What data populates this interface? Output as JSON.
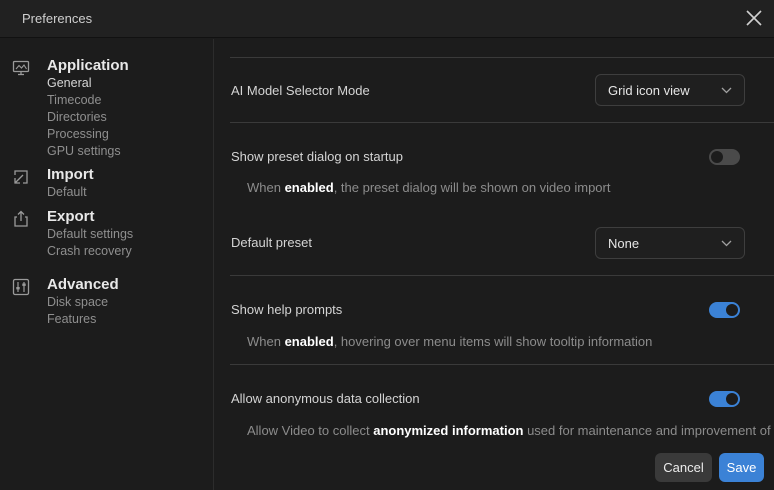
{
  "window": {
    "title": "Preferences"
  },
  "sidebar": {
    "sections": [
      {
        "heading": "Application",
        "icon": "monitor-icon",
        "items": [
          "General",
          "Timecode",
          "Directories",
          "Processing",
          "GPU settings"
        ]
      },
      {
        "heading": "Import",
        "icon": "import-icon",
        "items": [
          "Default"
        ]
      },
      {
        "heading": "Export",
        "icon": "export-icon",
        "items": [
          "Default settings",
          "Crash recovery"
        ]
      },
      {
        "heading": "Advanced",
        "icon": "sliders-icon",
        "items": [
          "Disk space",
          "Features"
        ]
      }
    ],
    "active_item": "General"
  },
  "settings": {
    "ai_model_selector": {
      "label": "AI Model Selector Mode",
      "value": "Grid icon view"
    },
    "preset_dialog": {
      "label": "Show preset dialog on startup",
      "enabled": false,
      "desc_pre": "When ",
      "desc_bold": "enabled",
      "desc_post": ", the preset dialog will be shown on video import"
    },
    "default_preset": {
      "label": "Default preset",
      "value": "None"
    },
    "help_prompts": {
      "label": "Show help prompts",
      "enabled": true,
      "desc_pre": "When ",
      "desc_bold": "enabled",
      "desc_post": ", hovering over menu items will show tooltip information"
    },
    "data_collection": {
      "label": "Allow anonymous data collection",
      "enabled": true,
      "desc_pre": "Allow Video to collect ",
      "desc_bold": "anonymized information",
      "desc_post": " used for maintenance and improvement of"
    }
  },
  "footer": {
    "cancel_label": "Cancel",
    "save_label": "Save"
  },
  "colors": {
    "accent": "#3b82d6",
    "background": "#1c1c1c",
    "toggle_off": "#4a4a4a"
  }
}
